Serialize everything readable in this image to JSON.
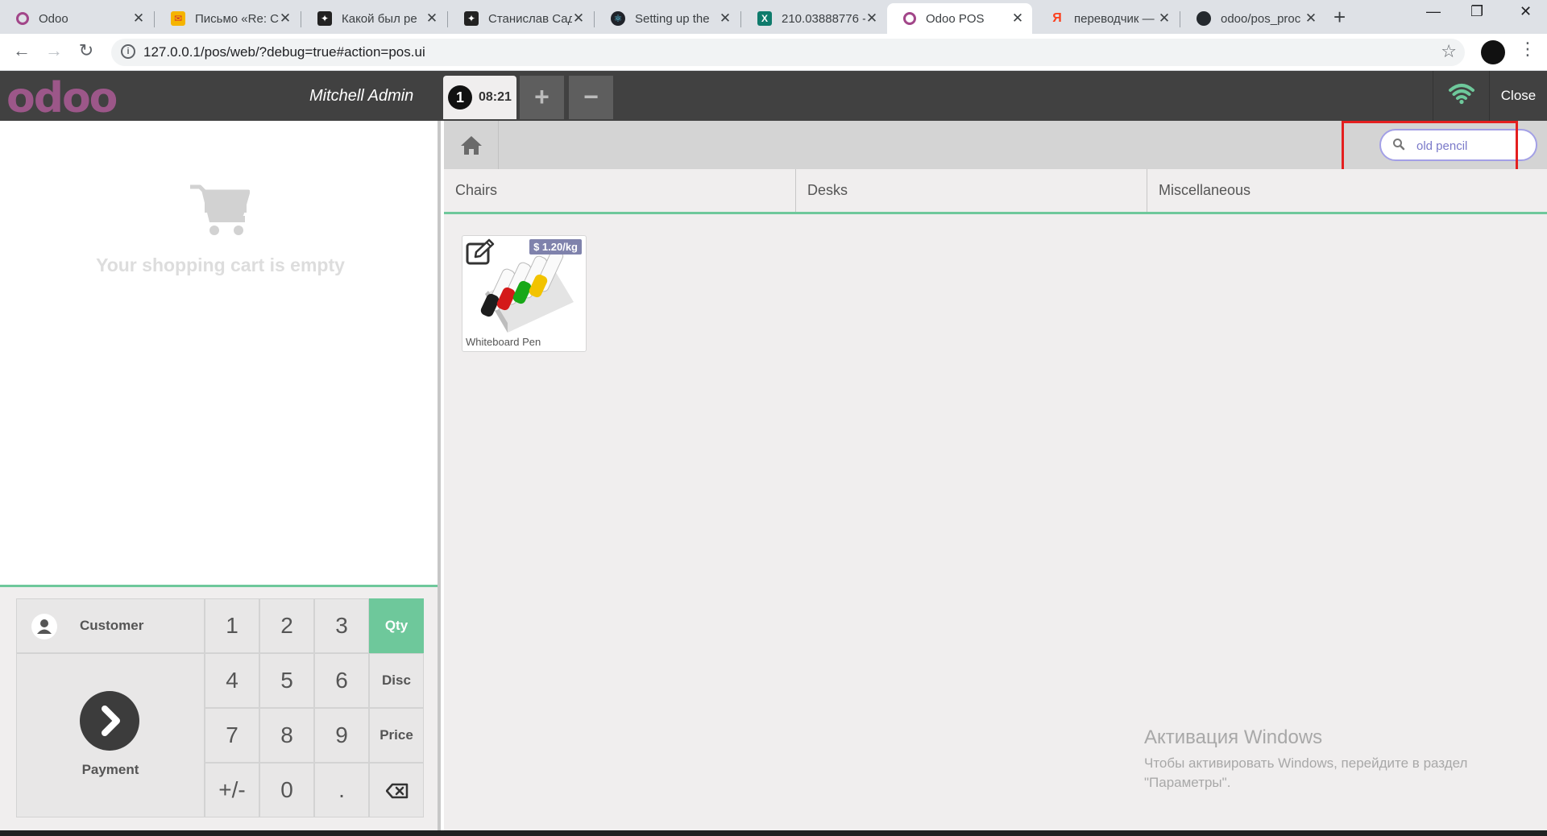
{
  "browser": {
    "tabs": [
      {
        "title": "Odoo",
        "icon": "odoo-icon"
      },
      {
        "title": "Письмо «Re: C",
        "icon": "mail-icon"
      },
      {
        "title": "Какой был ре",
        "icon": "star-icon"
      },
      {
        "title": "Станислав Сад",
        "icon": "star-icon"
      },
      {
        "title": "Setting up the",
        "icon": "react-icon"
      },
      {
        "title": "210.03888776 -",
        "icon": "excel-icon"
      },
      {
        "title": "Odoo POS",
        "icon": "odoo-icon"
      },
      {
        "title": "переводчик —",
        "icon": "yandex-icon"
      },
      {
        "title": "odoo/pos_proc",
        "icon": "github-icon"
      }
    ],
    "active_tab_index": 6,
    "url": "127.0.0.1/pos/web/?debug=true#action=pos.ui"
  },
  "header": {
    "logo": "odoo",
    "user": "Mitchell Admin",
    "order": {
      "number": "1",
      "time": "08:21"
    },
    "close_label": "Close",
    "connection_color": "#6ec89b"
  },
  "cart": {
    "empty_text": "Your shopping cart is empty"
  },
  "pad": {
    "customer_label": "Customer",
    "payment_label": "Payment",
    "keys": {
      "k1": "1",
      "k2": "2",
      "k3": "3",
      "k4": "4",
      "k5": "5",
      "k6": "6",
      "k7": "7",
      "k8": "8",
      "k9": "9",
      "sign": "+/-",
      "k0": "0",
      "dot": "."
    },
    "modes": {
      "qty": "Qty",
      "disc": "Disc",
      "price": "Price"
    },
    "selected_mode": "Qty"
  },
  "search": {
    "value": "old pencil"
  },
  "categories": [
    "Chairs",
    "Desks",
    "Miscellaneous"
  ],
  "products": [
    {
      "name": "Whiteboard Pen",
      "price": "$ 1.20/kg"
    }
  ],
  "windows_activation": {
    "title": "Активация Windows",
    "line1": "Чтобы активировать Windows, перейдите в раздел",
    "line2": "\"Параметры\"."
  },
  "colors": {
    "accent": "#6ec89b",
    "header_bg": "#414141",
    "highlight": "#e41f1f",
    "logo": "#9c5789"
  }
}
